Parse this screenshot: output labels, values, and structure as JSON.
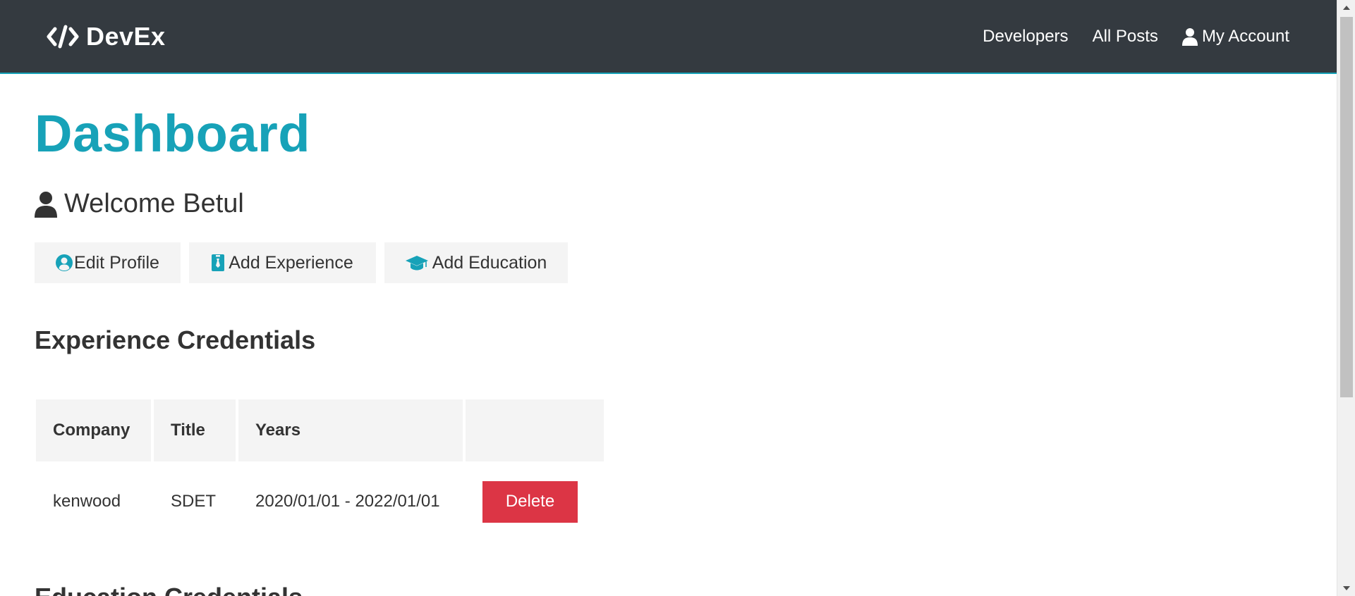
{
  "navbar": {
    "brand": "DevEx",
    "links": [
      {
        "label": "Developers"
      },
      {
        "label": "All Posts"
      },
      {
        "label": "My Account"
      }
    ]
  },
  "dashboard": {
    "title": "Dashboard",
    "welcome": "Welcome Betul",
    "actions": {
      "edit_profile": "Edit Profile",
      "add_experience": "Add Experience",
      "add_education": "Add Education"
    }
  },
  "experience": {
    "heading": "Experience Credentials",
    "columns": [
      "Company",
      "Title",
      "Years",
      ""
    ],
    "rows": [
      {
        "company": "kenwood",
        "title": "SDET",
        "years": "2020/01/01 - 2022/01/01",
        "action": "Delete"
      }
    ]
  },
  "education": {
    "heading": "Education Credentials"
  },
  "colors": {
    "navbar": "#343a40",
    "primary": "#17a2b8",
    "danger": "#dc3545",
    "light": "#f4f4f4"
  }
}
